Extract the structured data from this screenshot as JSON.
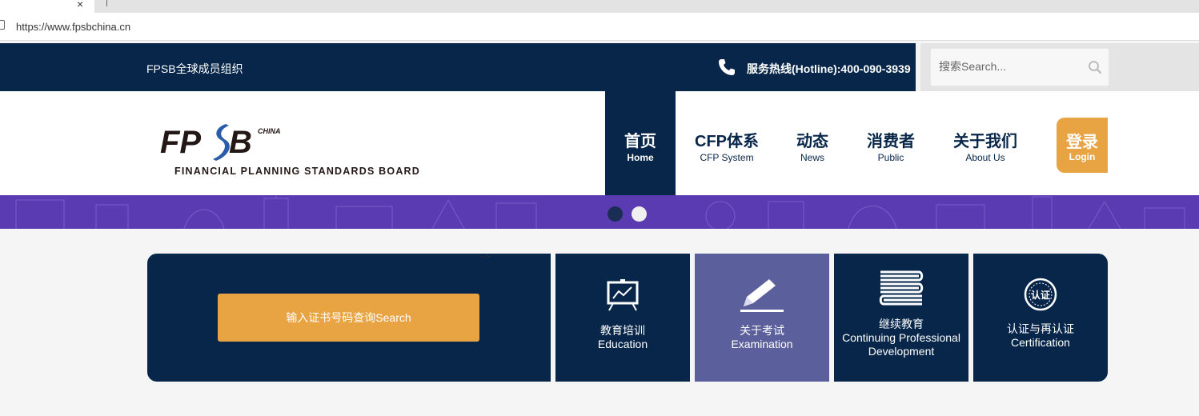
{
  "browser": {
    "url": "https://www.fpsbchina.cn",
    "tab_close": "×"
  },
  "topbar": {
    "member_text": "FPSB全球成员组织",
    "hotline": "服务热线(Hotline):400-090-3939",
    "search_placeholder": "搜索Search..."
  },
  "logo": {
    "main": "FPSB",
    "tag": "CHINA",
    "subtitle": "FINANCIAL PLANNING STANDARDS BOARD"
  },
  "nav": {
    "items": [
      {
        "zh": "首页",
        "en": "Home"
      },
      {
        "zh": "CFP体系",
        "en": "CFP System"
      },
      {
        "zh": "动态",
        "en": "News"
      },
      {
        "zh": "消费者",
        "en": "Public"
      },
      {
        "zh": "关于我们",
        "en": "About Us"
      }
    ],
    "login": {
      "zh": "登录",
      "en": "Login"
    }
  },
  "banner": {
    "slides": 2,
    "active_slide": 1
  },
  "content": {
    "search_button": "输入证书号码查询Search",
    "stray_text": "-->",
    "tiles": [
      {
        "zh": "教育培训",
        "en": "Education",
        "icon": "presentation-board-icon"
      },
      {
        "zh": "关于考试",
        "en": "Examination",
        "icon": "pencil-icon"
      },
      {
        "zh": "继续教育",
        "en": "Continuing Professional Development",
        "icon": "books-icon"
      },
      {
        "zh": "认证与再认证",
        "en": "Certification",
        "icon": "certification-seal-icon",
        "seal_text": "认证"
      }
    ]
  },
  "colors": {
    "navy": "#07264a",
    "orange": "#e8a342",
    "exam_tile": "#5b5f9c",
    "banner": "#5b3bb2"
  }
}
